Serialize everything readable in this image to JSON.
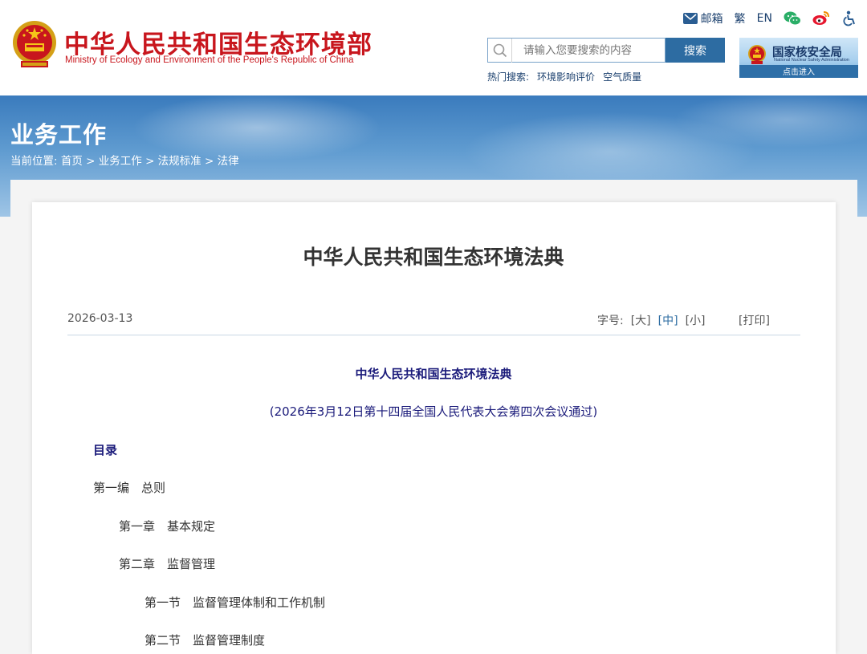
{
  "header": {
    "site_name_cn": "中华人民共和国生态环境部",
    "site_name_en": "Ministry of Ecology and Environment of the People's Republic of China",
    "top_links": {
      "mail": "邮箱",
      "traditional": "繁",
      "english": "EN"
    },
    "search": {
      "placeholder": "请输入您要搜索的内容",
      "button": "搜索"
    },
    "hot_search": {
      "label": "热门搜索:",
      "keywords": [
        "环境影响评价",
        "空气质量"
      ]
    },
    "nnsa": {
      "title": "国家核安全局",
      "subtitle": "National Nuclear Safety Administration",
      "enter": "点击进入"
    },
    "icons": [
      "mail-icon",
      "wechat-icon",
      "weibo-icon",
      "accessibility-icon"
    ]
  },
  "banner": {
    "title": "业务工作",
    "breadcrumb": {
      "label": "当前位置:",
      "items": [
        "首页",
        "业务工作",
        "法规标准",
        "法律"
      ],
      "separator": ">"
    }
  },
  "article": {
    "title": "中华人民共和国生态环境法典",
    "date": "2026-03-13",
    "font_size_label": "字号:",
    "font_sizes": [
      "[大]",
      "[中]",
      "[小]"
    ],
    "active_font_size": "[中]",
    "print": "[打印]",
    "law_title": "中华人民共和国生态环境法典",
    "law_subtitle": "(2026年3月12日第十四届全国人民代表大会第四次会议通过)",
    "toc_title": "目录",
    "toc": [
      {
        "level": 1,
        "text": "第一编　总则"
      },
      {
        "level": 2,
        "text": "第一章　基本规定"
      },
      {
        "level": 2,
        "text": "第二章　监督管理"
      },
      {
        "level": 3,
        "text": "第一节　监督管理体制和工作机制"
      },
      {
        "level": 3,
        "text": "第二节　监督管理制度"
      }
    ]
  },
  "colors": {
    "brand_red": "#c8161d",
    "link_blue": "#2d6ca2",
    "navy": "#1a1a7a"
  }
}
